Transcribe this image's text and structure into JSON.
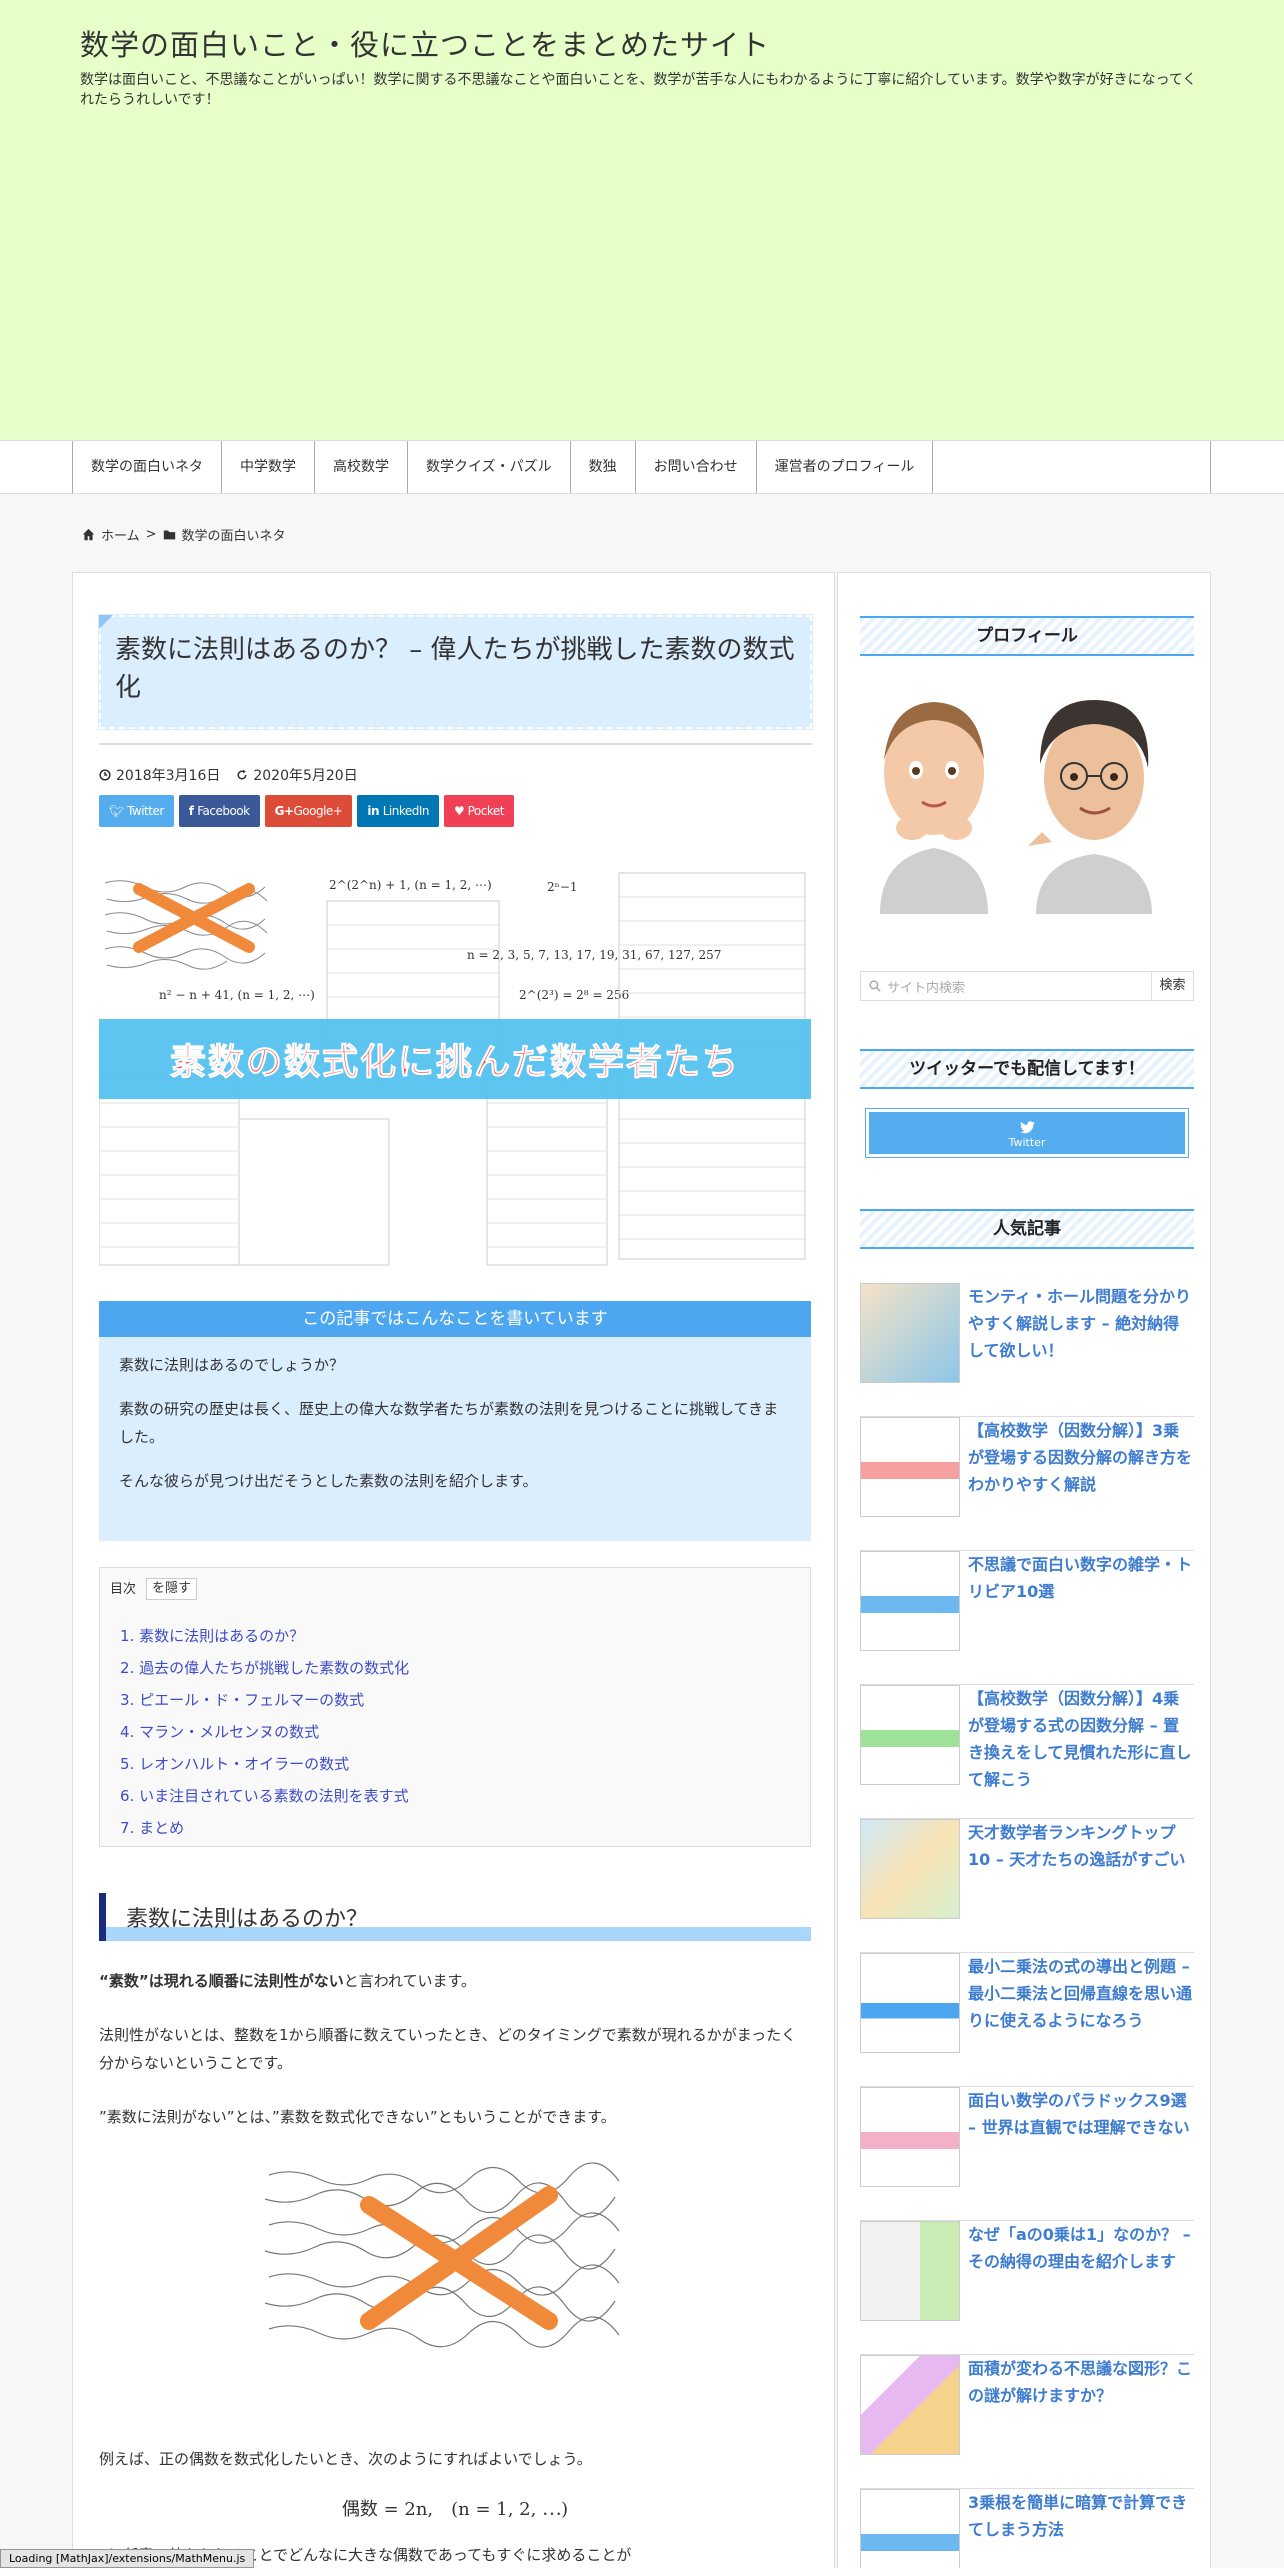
{
  "site": {
    "title": "数学の面白いこと・役に立つことをまとめたサイト",
    "description": "数学は面白いこと、不思議なことがいっぱい！数学に関する不思議なことや面白いことを、数学が苦手な人にもわかるように丁寧に紹介しています。数学や数字が好きになってくれたらうれしいです！"
  },
  "nav": [
    "数学の面白いネタ",
    "中学数学",
    "高校数学",
    "数学クイズ・パズル",
    "数独",
    "お問い合わせ",
    "運営者のプロフィール"
  ],
  "breadcrumb": {
    "home": "ホーム",
    "separator": ">",
    "category": "数学の面白いネタ"
  },
  "post": {
    "title": "素数に法則はあるのか？ – 偉人たちが挑戦した素数の数式化",
    "published": "2018年3月16日",
    "updated": "2020年5月20日",
    "eyecatch_caption": "素数の数式化に挑んだ数学者たち"
  },
  "share": [
    {
      "label": "Twitter",
      "icon": "twitter-icon",
      "color": "#55acee"
    },
    {
      "label": "Facebook",
      "icon": "facebook-icon",
      "color": "#3b5998"
    },
    {
      "label": "Google+",
      "icon": "google-plus-icon",
      "color": "#dd4b39"
    },
    {
      "label": "LinkedIn",
      "icon": "linkedin-icon",
      "color": "#0077b5"
    },
    {
      "label": "Pocket",
      "icon": "pocket-icon",
      "color": "#ef4056"
    }
  ],
  "summary": {
    "heading": "この記事ではこんなことを書いています",
    "lines": [
      "素数に法則はあるのでしょうか？",
      "素数の研究の歴史は長く、歴史上の偉大な数学者たちが素数の法則を見つけることに挑戦してきました。",
      "そんな彼らが見つけ出だそうとした素数の法則を紹介します。"
    ]
  },
  "toc": {
    "label": "目次",
    "toggle": "を隠す",
    "items": [
      "1. 素数に法則はあるのか？",
      "2. 過去の偉人たちが挑戦した素数の数式化",
      "3. ピエール・ド・フェルマーの数式",
      "4. マラン・メルセンヌの数式",
      "5. レオンハルト・オイラーの数式",
      "6. いま注目されている素数の法則を表す式",
      "7. まとめ"
    ]
  },
  "section1": {
    "heading": "素数に法則はあるのか？",
    "p1_bold": "“素数”は現れる順番に法則性がない",
    "p1_rest": "と言われています。",
    "p2": "法則性がないとは、整数を1から順番に数えていったとき、どのタイミングで素数が現れるかがまったく分からないということです。",
    "p3": "”素数に法則がない”とは、”素数を数式化できない”ともいうことができます。",
    "p4": "例えば、正の偶数を数式化したいとき、次のようにすればよいでしょう。",
    "equation": "偶数 = 2n,　(n = 1, 2, ⋯)",
    "p5": "nに任意の値を入れることでどんなに大きな偶数であってもすぐに求めることが"
  },
  "sidebar": {
    "profile_title": "プロフィール",
    "search_placeholder": "サイト内検索",
    "search_button": "検索",
    "twitter_title": "ツイッターでも配信してます！",
    "twitter_button": "Twitter",
    "popular_title": "人気記事",
    "popular": [
      "モンティ・ホール問題を分かりやすく解説します – 絶対納得して欲しい！",
      "【高校数学（因数分解）】3乗が登場する因数分解の解き方をわかりやすく解説",
      "不思議で面白い数字の雑学・トリビア10選",
      "【高校数学（因数分解）】4乗が登場する式の因数分解 – 置き換えをして見慣れた形に直して解こう",
      "天才数学者ランキングトップ10 – 天才たちの逸話がすごい",
      "最小二乗法の式の導出と例題 – 最小二乗法と回帰直線を思い通りに使えるようになろう",
      "面白い数学のパラドックス9選 – 世界は直観では理解できない",
      "なぜ「aの0乗は1」なのか？ – その納得の理由を紹介します",
      "面積が変わる不思議な図形？この謎が解けますか？",
      "3乗根を簡単に暗算で計算できてしまう方法"
    ]
  },
  "status_bar": "Loading [MathJax]/extensions/MathMenu.js"
}
